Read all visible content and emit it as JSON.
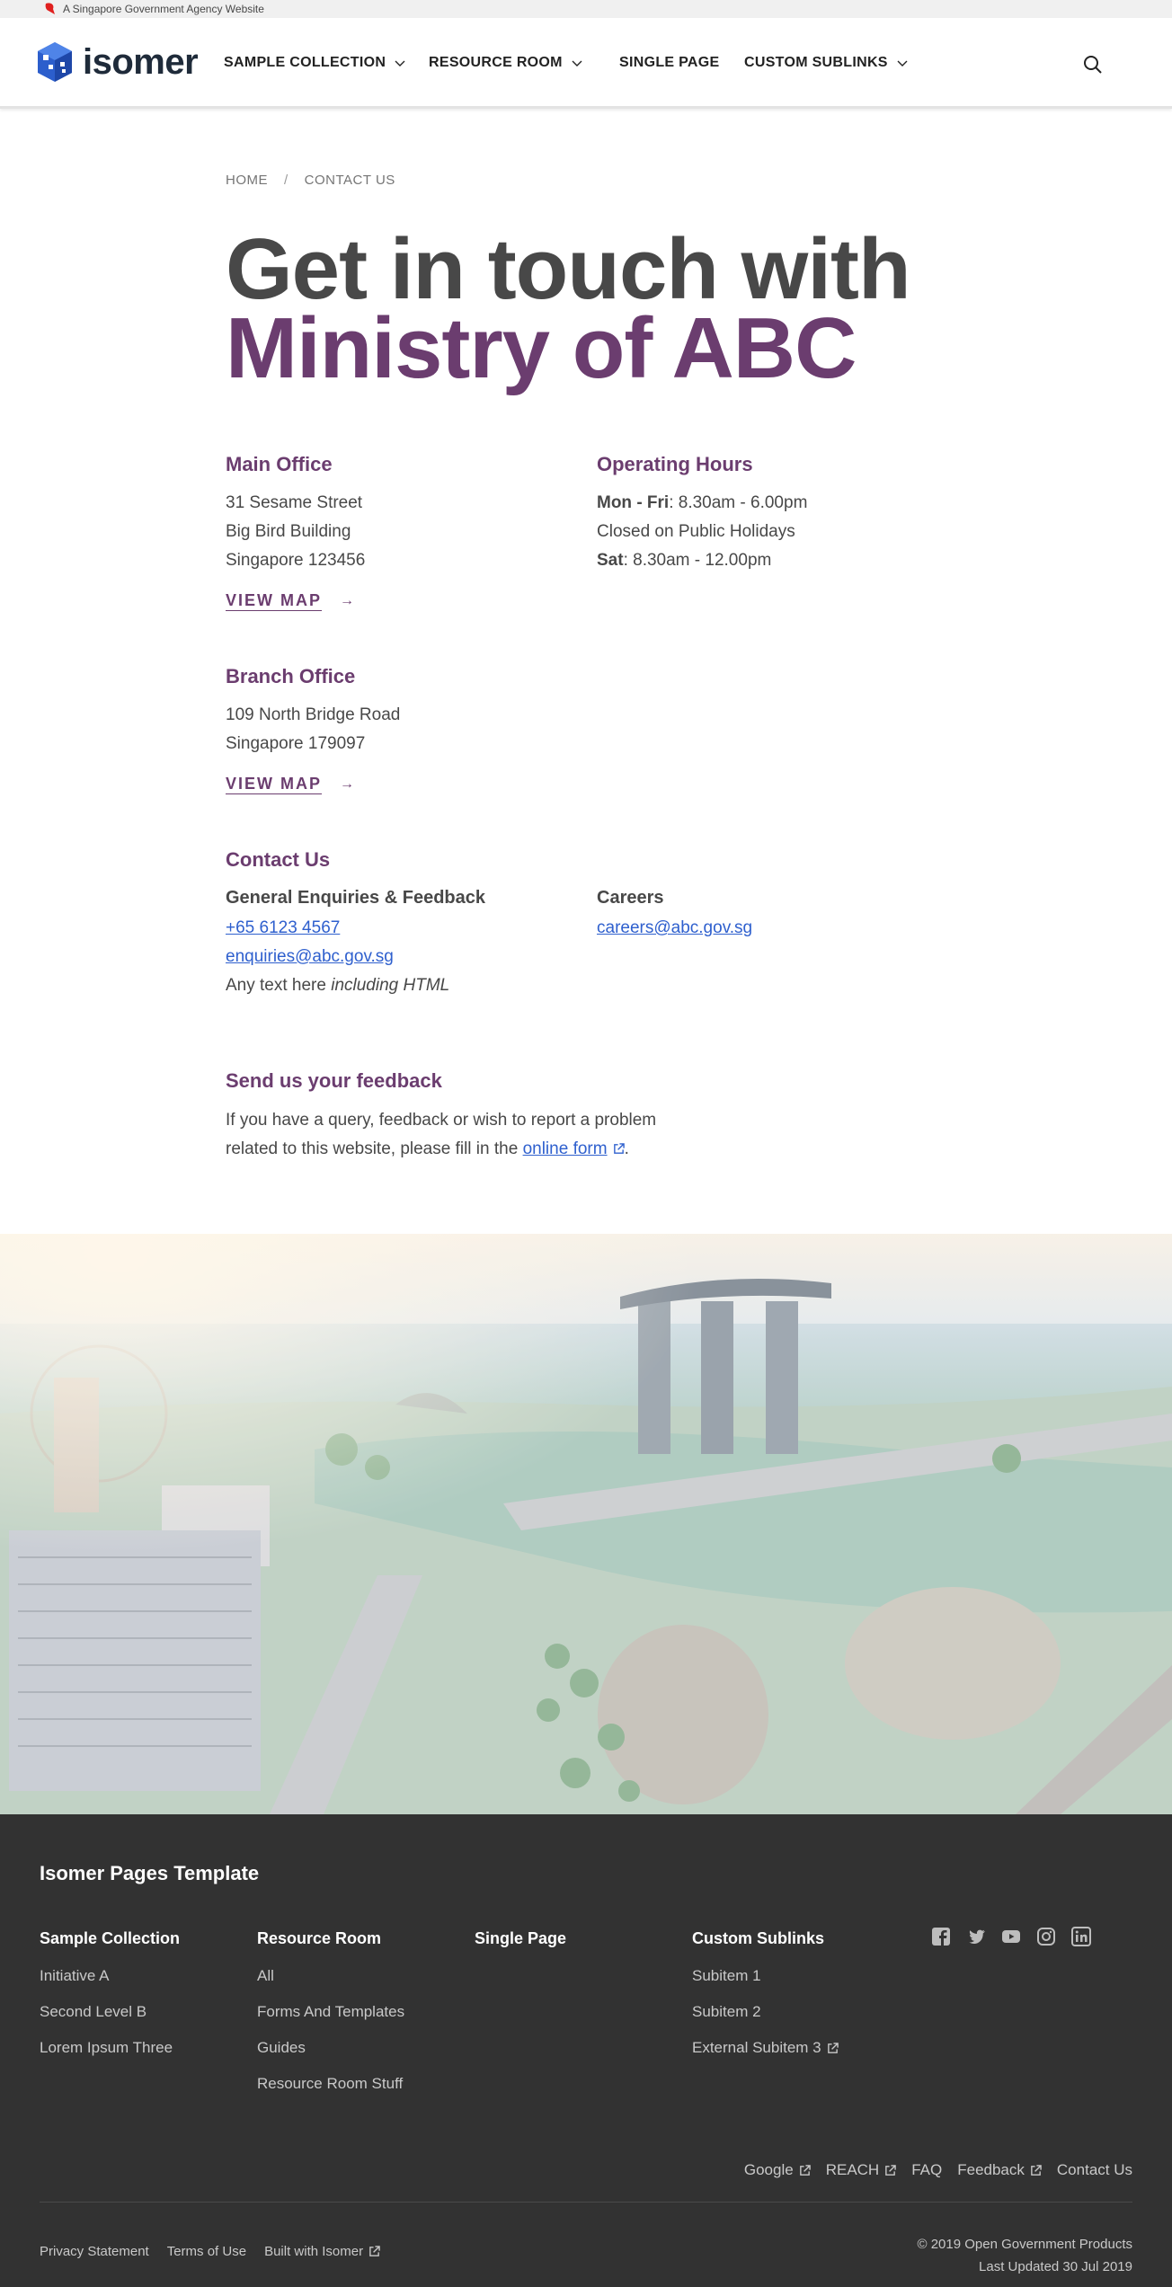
{
  "masthead": {
    "text": "A Singapore Government Agency Website"
  },
  "navbar": {
    "brand": "isomer",
    "items": [
      {
        "label": "SAMPLE COLLECTION",
        "has_dropdown": true
      },
      {
        "label": "RESOURCE ROOM",
        "has_dropdown": true
      },
      {
        "label": "SINGLE PAGE",
        "has_dropdown": false
      },
      {
        "label": "CUSTOM SUBLINKS",
        "has_dropdown": true
      }
    ],
    "search_icon": "search-icon"
  },
  "breadcrumb": {
    "home": "HOME",
    "sep": "/",
    "current": "CONTACT US"
  },
  "title": {
    "line1": "Get in touch with",
    "line2": "Ministry of ABC"
  },
  "main_office": {
    "heading": "Main Office",
    "lines": [
      "31 Sesame Street",
      "Big Bird Building",
      "Singapore 123456"
    ],
    "map_label": "VIEW MAP",
    "arrow": "→"
  },
  "operating_hours": {
    "heading": "Operating Hours",
    "l1_bold": "Mon - Fri",
    "l1_rest": ": 8.30am - 6.00pm",
    "l2": "Closed on Public Holidays",
    "l3_bold": "Sat",
    "l3_rest": ": 8.30am - 12.00pm"
  },
  "branch_office": {
    "heading": "Branch Office",
    "lines": [
      "109 North Bridge Road",
      "Singapore 179097"
    ],
    "map_label": "VIEW MAP",
    "arrow": "→"
  },
  "contact_us": {
    "heading": "Contact Us",
    "general_heading": "General Enquiries & Feedback",
    "phone": "+65 6123 4567",
    "email": "enquiries@abc.gov.sg",
    "text_plain": "Any text here ",
    "text_em": "including HTML",
    "careers_heading": "Careers",
    "careers_email": "careers@abc.gov.sg"
  },
  "feedback": {
    "heading": "Send us your feedback",
    "line1": "If you have a query, feedback or wish to report a problem",
    "line2_pre": "related to this website, please fill in the ",
    "link": "online form",
    "line2_post": "."
  },
  "footer": {
    "title": "Isomer Pages Template",
    "columns": [
      {
        "heading": "Sample Collection",
        "links": [
          "Initiative A",
          "Second Level B",
          "Lorem Ipsum Three"
        ]
      },
      {
        "heading": "Resource Room",
        "links": [
          "All",
          "Forms And Templates",
          "Guides",
          "Resource Room Stuff"
        ]
      },
      {
        "heading": "Single Page",
        "links": []
      },
      {
        "heading": "Custom Sublinks",
        "links": [
          "Subitem 1",
          "Subitem 2",
          "External Subitem 3"
        ]
      }
    ],
    "social": [
      "facebook-icon",
      "twitter-icon",
      "youtube-icon",
      "instagram-icon",
      "linkedin-icon"
    ],
    "links": [
      "Google",
      "REACH",
      "FAQ",
      "Feedback",
      "Contact Us"
    ],
    "bottom_links": [
      "Privacy Statement",
      "Terms of Use",
      "Built with Isomer"
    ],
    "copyright": "© 2019 Open Government Products",
    "updated": "Last Updated 30 Jul 2019"
  },
  "colors": {
    "accent": "#6b3d6f",
    "link": "#2f60ce",
    "footer_bg": "#323232",
    "text": "#484848"
  }
}
